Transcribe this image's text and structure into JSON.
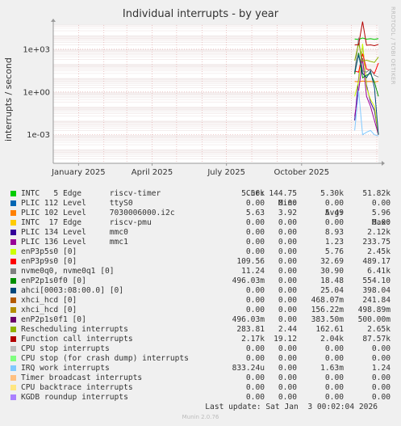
{
  "header": {
    "title": "Individual interrupts - by year",
    "side_text": "RRDTOOL / TOBI OETIKER",
    "footer_text": "Munin 2.0.76",
    "last_update": "Last update: Sat Jan  3 00:02:04 2026"
  },
  "legend_header": {
    "cur": "Cur:",
    "min": "Min:",
    "avg": "Avg:",
    "max": "Max:"
  },
  "legend": [
    {
      "name": "INTC   5 Edge      riscv-timer",
      "color": "#00cc00",
      "cur": "5.56k",
      "min": "144.75",
      "avg": "5.30k",
      "max": "51.82k"
    },
    {
      "name": "PLIC 112 Level     ttyS0",
      "color": "#0066b3",
      "cur": "0.00",
      "min": "0.00",
      "avg": "0.00",
      "max": "0.00"
    },
    {
      "name": "PLIC 102 Level     7030006000.i2c",
      "color": "#ff8000",
      "cur": "5.63",
      "min": "3.92",
      "avg": "5.49",
      "max": "5.96"
    },
    {
      "name": "INTC  17 Edge      riscv-pmu",
      "color": "#ffcc00",
      "cur": "0.00",
      "min": "0.00",
      "avg": "0.00",
      "max": "0.00"
    },
    {
      "name": "PLIC 134 Level     mmc0",
      "color": "#330099",
      "cur": "0.00",
      "min": "0.00",
      "avg": "8.93",
      "max": "2.12k"
    },
    {
      "name": "PLIC 136 Level     mmc1",
      "color": "#990099",
      "cur": "0.00",
      "min": "0.00",
      "avg": "1.23",
      "max": "233.75"
    },
    {
      "name": "enP3p5s0 [0]",
      "color": "#ccff00",
      "cur": "0.00",
      "min": "0.00",
      "avg": "5.76",
      "max": "2.45k"
    },
    {
      "name": "enP3p9s0 [0]",
      "color": "#ff0000",
      "cur": "109.56",
      "min": "0.00",
      "avg": "32.69",
      "max": "489.17"
    },
    {
      "name": "nvme0q0, nvme0q1 [0]",
      "color": "#808080",
      "cur": "11.24",
      "min": "0.00",
      "avg": "30.90",
      "max": "6.41k"
    },
    {
      "name": "enP2p1s0f0 [0]",
      "color": "#008f00",
      "cur": "496.03m",
      "min": "0.00",
      "avg": "18.48",
      "max": "554.10"
    },
    {
      "name": "ahci[0003:08:00.0] [0]",
      "color": "#00487d",
      "cur": "0.00",
      "min": "0.00",
      "avg": "25.04",
      "max": "398.04"
    },
    {
      "name": "xhci_hcd [0]",
      "color": "#b35a00",
      "cur": "0.00",
      "min": "0.00",
      "avg": "468.07m",
      "max": "241.84"
    },
    {
      "name": "xhci_hcd [0]",
      "color": "#b38f00",
      "cur": "0.00",
      "min": "0.00",
      "avg": "156.22m",
      "max": "498.89m"
    },
    {
      "name": "enP2p1s0f1 [0]",
      "color": "#6b006b",
      "cur": "496.03m",
      "min": "0.00",
      "avg": "383.50m",
      "max": "500.00m"
    },
    {
      "name": "Rescheduling interrupts",
      "color": "#8fb300",
      "cur": "283.81",
      "min": "2.44",
      "avg": "162.61",
      "max": "2.65k"
    },
    {
      "name": "Function call interrupts",
      "color": "#b30000",
      "cur": "2.17k",
      "min": "19.12",
      "avg": "2.04k",
      "max": "87.57k"
    },
    {
      "name": "CPU stop interrupts",
      "color": "#bebebe",
      "cur": "0.00",
      "min": "0.00",
      "avg": "0.00",
      "max": "0.00"
    },
    {
      "name": "CPU stop (for crash dump) interrupts",
      "color": "#80ff80",
      "cur": "0.00",
      "min": "0.00",
      "avg": "0.00",
      "max": "0.00"
    },
    {
      "name": "IRQ work interrupts",
      "color": "#80c9ff",
      "cur": "833.24u",
      "min": "0.00",
      "avg": "1.63m",
      "max": "1.24"
    },
    {
      "name": "Timer broadcast interrupts",
      "color": "#ffc080",
      "cur": "0.00",
      "min": "0.00",
      "avg": "0.00",
      "max": "0.00"
    },
    {
      "name": "CPU backtrace interrupts",
      "color": "#ffe680",
      "cur": "0.00",
      "min": "0.00",
      "avg": "0.00",
      "max": "0.00"
    },
    {
      "name": "KGDB roundup interrupts",
      "color": "#aa80ff",
      "cur": "0.00",
      "min": "0.00",
      "avg": "0.00",
      "max": "0.00"
    }
  ],
  "chart_data": {
    "type": "line",
    "title": "Individual interrupts - by year",
    "ylabel": "interrupts / second",
    "yscale": "log",
    "y_ticks": [
      "1e+03",
      "1e+00",
      "1e-03"
    ],
    "y_tick_values": [
      1000,
      1,
      0.001
    ],
    "ylim": [
      1e-05,
      50000
    ],
    "x_ticks": [
      "January 2025",
      "April 2025",
      "July 2025",
      "October 2025"
    ],
    "xlim": [
      "2024-12-01",
      "2026-01-03"
    ],
    "grid": true,
    "data_start": "2025-12-05",
    "series": [
      {
        "name": "INTC   5 Edge      riscv-timer",
        "color": "#00cc00",
        "values": [
          5300,
          4800,
          6200,
          5100,
          5500,
          4900,
          5560
        ]
      },
      {
        "name": "PLIC 102 Level     7030006000.i2c",
        "color": "#ff8000",
        "values": [
          5.5,
          5.2,
          5.9,
          5.4,
          5.6,
          5.0,
          5.63
        ]
      },
      {
        "name": "PLIC 134 Level     mmc0",
        "color": "#330099",
        "values": [
          0.01,
          8.9,
          2120,
          3,
          0.2,
          0.05,
          0.001
        ]
      },
      {
        "name": "PLIC 136 Level     mmc1",
        "color": "#990099",
        "values": [
          0.02,
          1.2,
          233.75,
          0.5,
          0.1,
          0.01,
          0.001
        ]
      },
      {
        "name": "enP3p5s0 [0]",
        "color": "#ccff00",
        "values": [
          0.5,
          5.8,
          2450,
          2,
          0.3,
          0.1,
          0.001
        ]
      },
      {
        "name": "enP3p9s0 [0]",
        "color": "#ff0000",
        "values": [
          30,
          25,
          489.17,
          40,
          35,
          20,
          109.56
        ]
      },
      {
        "name": "nvme0q0, nvme0q1 [0]",
        "color": "#808080",
        "values": [
          20,
          6410,
          30,
          25,
          40,
          15,
          11.24
        ]
      },
      {
        "name": "enP2p1s0f0 [0]",
        "color": "#008f00",
        "values": [
          18,
          554.1,
          10,
          15,
          20,
          5,
          0.496
        ]
      },
      {
        "name": "ahci[0003:08:00.0] [0]",
        "color": "#00487d",
        "values": [
          25,
          398.04,
          20,
          10,
          30,
          2,
          0.001
        ]
      },
      {
        "name": "Rescheduling interrupts",
        "color": "#8fb300",
        "values": [
          160,
          2650,
          150,
          170,
          140,
          120,
          283.81
        ]
      },
      {
        "name": "Function call interrupts",
        "color": "#b30000",
        "values": [
          2000,
          2100,
          87570,
          1900,
          2050,
          1800,
          2170
        ]
      },
      {
        "name": "IRQ work interrupts",
        "color": "#80c9ff",
        "values": [
          0.002,
          1.24,
          0.001,
          0.0015,
          0.002,
          0.001,
          0.00083
        ]
      }
    ]
  }
}
